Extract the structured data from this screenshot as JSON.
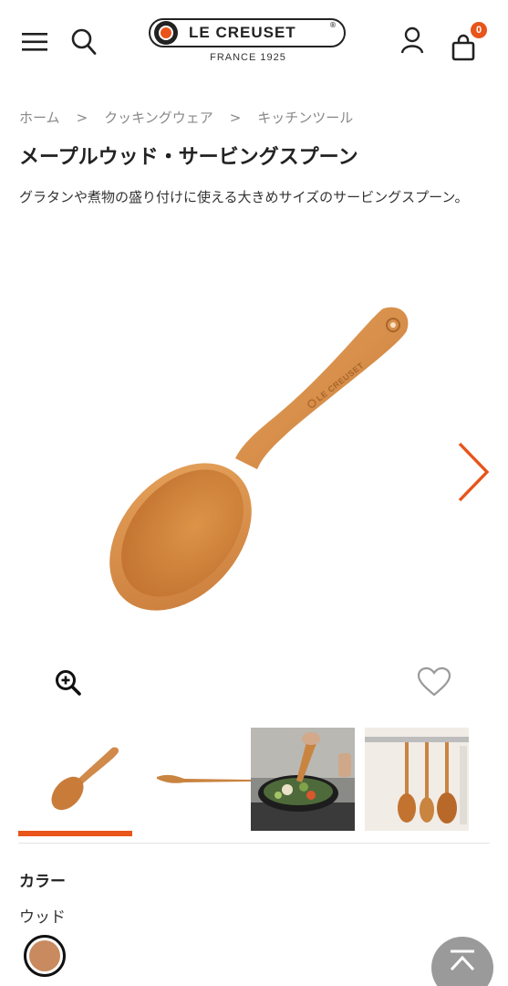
{
  "header": {
    "logo_text": "LE CREUSET",
    "logo_sub": "FRANCE 1925",
    "cart_count": "0",
    "icons": [
      "menu-icon",
      "search-icon",
      "account-icon",
      "cart-icon"
    ]
  },
  "breadcrumb": {
    "items": [
      "ホーム",
      "クッキングウェア",
      "キッチンツール"
    ],
    "separator": ">"
  },
  "product": {
    "title": "メープルウッド・サービングスプーン",
    "description": "グラタンや煮物の盛り付けに使える大きめサイズのサービングスプーン。",
    "logo_engraving": "LE CREUSET"
  },
  "gallery": {
    "thumbnails": [
      "spoon-front",
      "spoon-side",
      "cooking-scene",
      "hanging-utensils"
    ],
    "active_index": 0
  },
  "color": {
    "label": "カラー",
    "value": "ウッド",
    "swatch": "#c98a5f"
  },
  "colors": {
    "accent": "#e8541a",
    "wood": "#d08a4a"
  }
}
